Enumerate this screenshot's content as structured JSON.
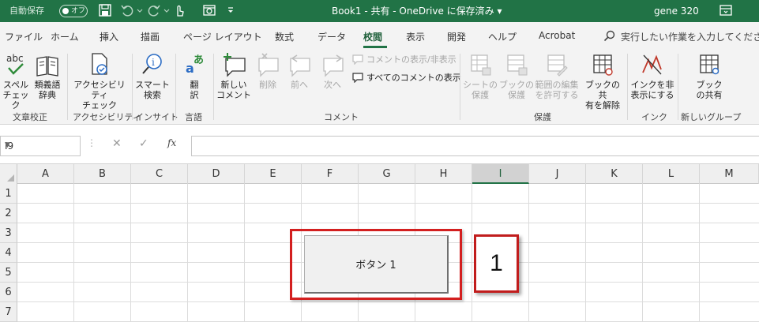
{
  "titlebar": {
    "autosave_label": "自動保存",
    "autosave_state": "オフ",
    "doc_title": "Book1 - 共有 - OneDrive に保存済み ▾",
    "user_name": "gene 320",
    "bg_color": "#217346"
  },
  "tabs": [
    "ファイル",
    "ホーム",
    "挿入",
    "描画",
    "ページ レイアウト",
    "数式",
    "データ",
    "校閲",
    "表示",
    "開発",
    "ヘルプ",
    "Acrobat"
  ],
  "active_tab": "校閲",
  "search": {
    "placeholder": "実行したい作業を入力してください"
  },
  "ribbon": {
    "spell_line1": "スペル",
    "spell_line2": "チェック",
    "thesaurus_line1": "類義語",
    "thesaurus_line2": "辞典",
    "group_proofing": "文章校正",
    "access_line1": "アクセシビリティ",
    "access_line2": "チェック",
    "group_access": "アクセシビリティ",
    "smart_line1": "スマート",
    "smart_line2": "検索",
    "group_insight": "インサイト",
    "translate_line1": "翻",
    "translate_line2": "訳",
    "group_language": "言語",
    "new_comment_line1": "新しい",
    "new_comment_line2": "コメント",
    "delete": "削除",
    "prev": "前へ",
    "next": "次へ",
    "show_hide_comment": "コメントの表示/非表示",
    "show_all_comments": "すべてのコメントの表示",
    "group_comments": "コメント",
    "protect_sheet_line1": "シートの",
    "protect_sheet_line2": "保護",
    "protect_book_line1": "ブックの",
    "protect_book_line2": "保護",
    "allow_edit_line1": "範囲の編集",
    "allow_edit_line2": "を許可する",
    "unshare_line1": "ブックの共",
    "unshare_line2": "有を解除",
    "group_protect": "保護",
    "hide_ink_line1": "インクを非",
    "hide_ink_line2": "表示にする",
    "group_ink": "インク",
    "share_book_line1": "ブック",
    "share_book_line2": "の共有",
    "group_new": "新しいグループ"
  },
  "formula_bar": {
    "name_box": "I9",
    "formula": ""
  },
  "columns": [
    "A",
    "B",
    "C",
    "D",
    "E",
    "F",
    "G",
    "H",
    "I",
    "J",
    "K",
    "L",
    "M"
  ],
  "selected_column": "I",
  "rows": [
    "1",
    "2",
    "3",
    "4",
    "5",
    "6",
    "7"
  ],
  "form_button": {
    "label": "ボタン 1"
  },
  "callout": {
    "number": "1",
    "border_color": "#c11d1d"
  },
  "highlight": {
    "color": "#d31f1f"
  }
}
